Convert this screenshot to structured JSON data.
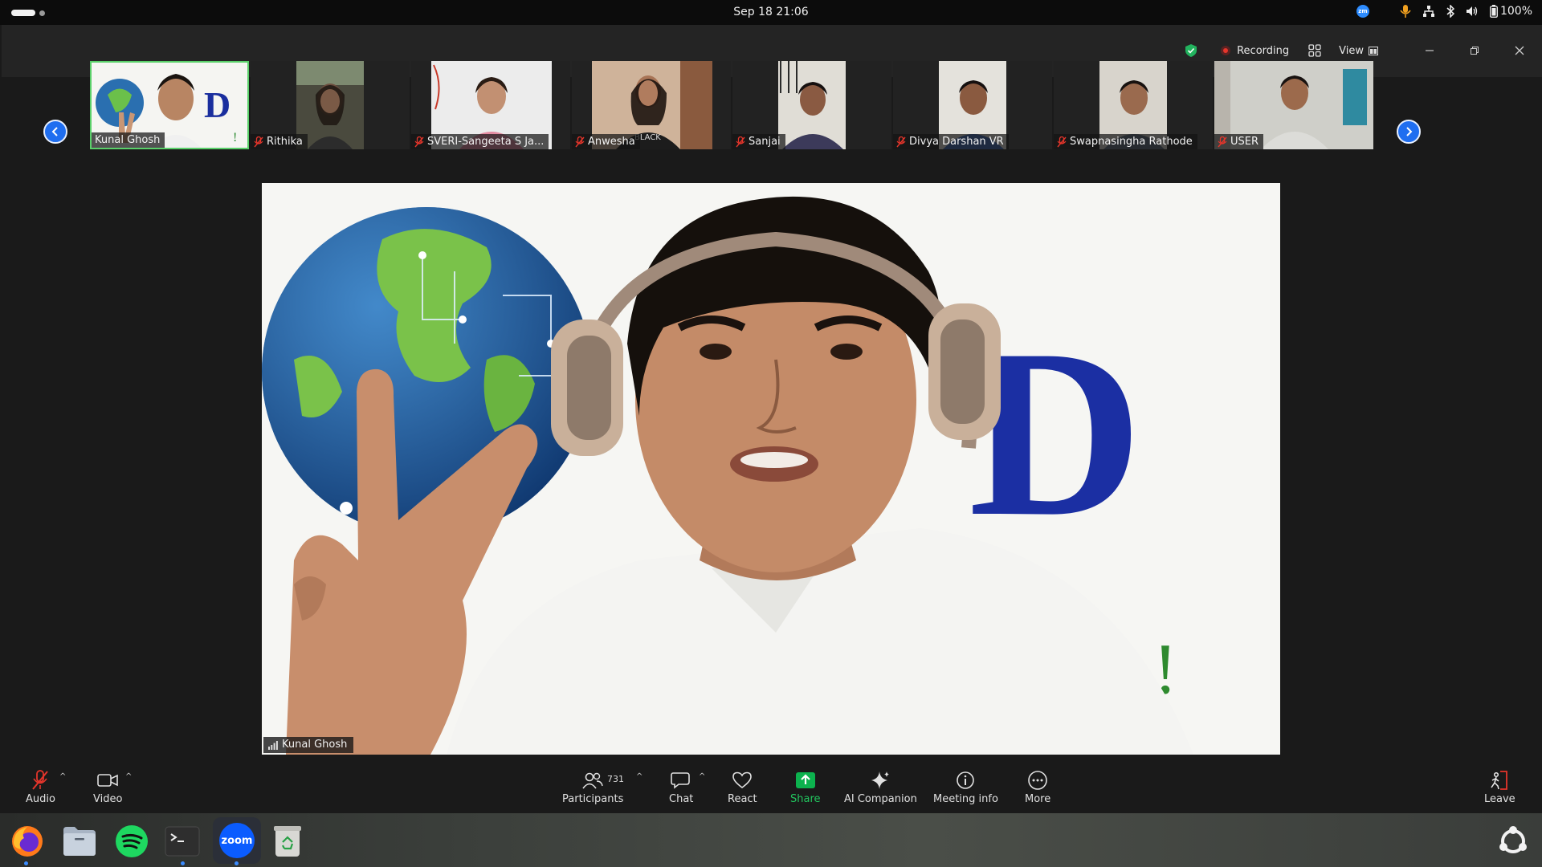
{
  "topbar": {
    "clock": "Sep 18  21:06",
    "battery": "100%",
    "icons": [
      "zoom-tray-icon",
      "microphone-icon",
      "network-icon",
      "bluetooth-icon",
      "volume-icon",
      "battery-icon"
    ]
  },
  "window": {
    "recording_label": "Recording",
    "view_label": "View",
    "controls": [
      "minimize-icon",
      "maximize-icon",
      "close-icon"
    ]
  },
  "gallery": {
    "tiles": [
      {
        "name": "Kunal Ghosh",
        "muted": false,
        "active": true
      },
      {
        "name": "Rithika",
        "muted": true
      },
      {
        "name": "SVERI-Sangeeta  S Ja...",
        "muted": true
      },
      {
        "name": "Anwesha",
        "muted": true
      },
      {
        "name": "Sanjai",
        "muted": true
      },
      {
        "name": "Divya Darshan VR",
        "muted": true
      },
      {
        "name": "Swapnasingha Rathode",
        "muted": true
      },
      {
        "name": "USER",
        "muted": true
      }
    ]
  },
  "speaker": {
    "name": "Kunal Ghosh",
    "backdrop_letter": "D",
    "backdrop_exclaim": "!"
  },
  "toolbar": {
    "audio": "Audio",
    "video": "Video",
    "participants": "Participants",
    "participants_count": "731",
    "chat": "Chat",
    "react": "React",
    "share": "Share",
    "ai_companion": "AI Companion",
    "meeting_info": "Meeting info",
    "more": "More",
    "leave": "Leave"
  },
  "dock": {
    "apps": [
      "firefox-icon",
      "files-icon",
      "spotify-icon",
      "terminal-icon",
      "zoom-icon",
      "trash-icon"
    ],
    "zoom_text": "zoom"
  },
  "colors": {
    "accent_blue": "#1f6ef0",
    "share_green": "#0cb24e",
    "active_border": "#5ad06a",
    "mute_red": "#e5352b"
  }
}
